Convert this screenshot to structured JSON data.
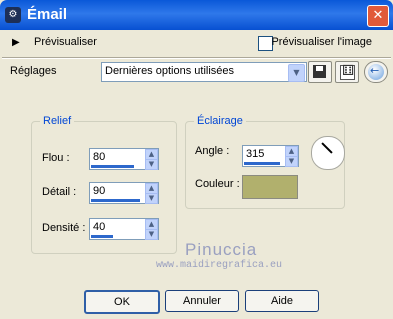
{
  "window": {
    "title": "Émail"
  },
  "preview": {
    "label": "Prévisualiser",
    "checkbox_label": "Prévisualiser l'image",
    "checked": false
  },
  "settings": {
    "label": "Réglages",
    "dropdown_value": "Dernières options utilisées"
  },
  "relief": {
    "title": "Relief",
    "flou_label": "Flou :",
    "flou_value": "80",
    "flou_level": 0.8,
    "detail_label": "Détail :",
    "detail_value": "90",
    "detail_level": 0.9,
    "densite_label": "Densité :",
    "densite_value": "40",
    "densite_level": 0.4
  },
  "eclairage": {
    "title": "Éclairage",
    "angle_label": "Angle :",
    "angle_value": "315",
    "angle_level": 0.875,
    "couleur_label": "Couleur :",
    "color": "#b1b06d"
  },
  "watermark": {
    "line1": "Pinuccia",
    "line2": "www.maidiregrafica.eu"
  },
  "buttons": {
    "ok": "OK",
    "cancel": "Annuler",
    "help": "Aide"
  },
  "icons": {
    "save": "save-icon",
    "random": "dice-icon",
    "reset": "reset-icon",
    "close": "close-icon"
  }
}
